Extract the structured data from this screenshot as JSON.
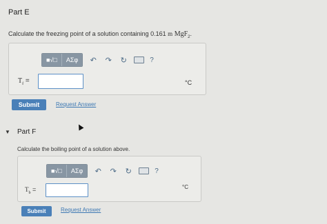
{
  "part_e": {
    "title": "Part E",
    "question_text": "Calculate the freezing point of a solution containing 0.161",
    "question_unit": "m",
    "question_formula": "MgF",
    "question_subscript": "2",
    "question_end": ".",
    "var_symbol": "T",
    "var_sub": "f",
    "var_eq": "=",
    "unit": "°C",
    "submit_label": "Submit",
    "request_label": "Request Answer"
  },
  "part_f": {
    "title": "Part F",
    "question_text": "Calculate the boiling point of a solution above.",
    "var_symbol": "T",
    "var_sub": "b",
    "var_eq": "=",
    "unit": "°C",
    "submit_label": "Submit",
    "request_label": "Request Answer"
  },
  "toolbar": {
    "templates_label": "■√□",
    "greek_label": "ΑΣφ",
    "undo_glyph": "↶",
    "redo_glyph": "↷",
    "reset_glyph": "↻",
    "help_glyph": "?"
  },
  "collapse_caret": "▼"
}
